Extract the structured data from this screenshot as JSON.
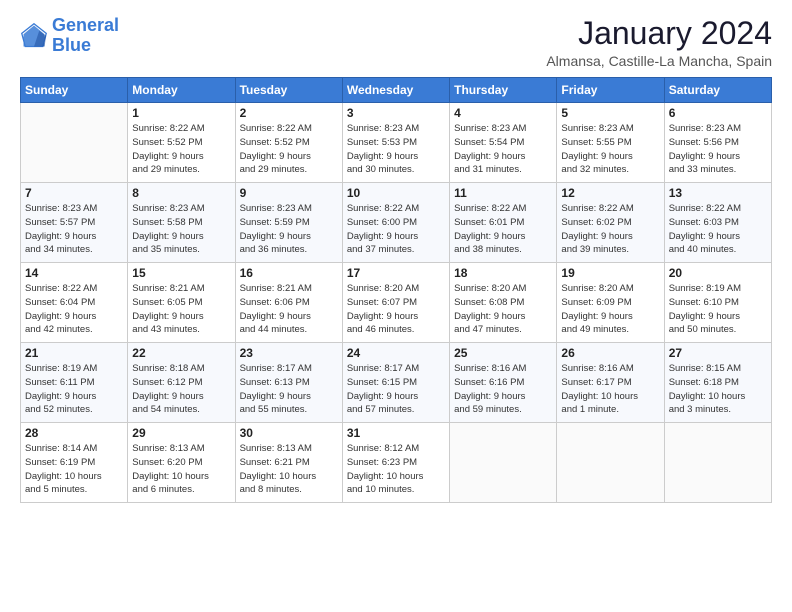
{
  "logo": {
    "line1": "General",
    "line2": "Blue"
  },
  "title": "January 2024",
  "location": "Almansa, Castille-La Mancha, Spain",
  "days_of_week": [
    "Sunday",
    "Monday",
    "Tuesday",
    "Wednesday",
    "Thursday",
    "Friday",
    "Saturday"
  ],
  "weeks": [
    [
      {
        "day": "",
        "info": ""
      },
      {
        "day": "1",
        "info": "Sunrise: 8:22 AM\nSunset: 5:52 PM\nDaylight: 9 hours\nand 29 minutes."
      },
      {
        "day": "2",
        "info": "Sunrise: 8:22 AM\nSunset: 5:52 PM\nDaylight: 9 hours\nand 29 minutes."
      },
      {
        "day": "3",
        "info": "Sunrise: 8:23 AM\nSunset: 5:53 PM\nDaylight: 9 hours\nand 30 minutes."
      },
      {
        "day": "4",
        "info": "Sunrise: 8:23 AM\nSunset: 5:54 PM\nDaylight: 9 hours\nand 31 minutes."
      },
      {
        "day": "5",
        "info": "Sunrise: 8:23 AM\nSunset: 5:55 PM\nDaylight: 9 hours\nand 32 minutes."
      },
      {
        "day": "6",
        "info": "Sunrise: 8:23 AM\nSunset: 5:56 PM\nDaylight: 9 hours\nand 33 minutes."
      }
    ],
    [
      {
        "day": "7",
        "info": "Sunrise: 8:23 AM\nSunset: 5:57 PM\nDaylight: 9 hours\nand 34 minutes."
      },
      {
        "day": "8",
        "info": "Sunrise: 8:23 AM\nSunset: 5:58 PM\nDaylight: 9 hours\nand 35 minutes."
      },
      {
        "day": "9",
        "info": "Sunrise: 8:23 AM\nSunset: 5:59 PM\nDaylight: 9 hours\nand 36 minutes."
      },
      {
        "day": "10",
        "info": "Sunrise: 8:22 AM\nSunset: 6:00 PM\nDaylight: 9 hours\nand 37 minutes."
      },
      {
        "day": "11",
        "info": "Sunrise: 8:22 AM\nSunset: 6:01 PM\nDaylight: 9 hours\nand 38 minutes."
      },
      {
        "day": "12",
        "info": "Sunrise: 8:22 AM\nSunset: 6:02 PM\nDaylight: 9 hours\nand 39 minutes."
      },
      {
        "day": "13",
        "info": "Sunrise: 8:22 AM\nSunset: 6:03 PM\nDaylight: 9 hours\nand 40 minutes."
      }
    ],
    [
      {
        "day": "14",
        "info": "Sunrise: 8:22 AM\nSunset: 6:04 PM\nDaylight: 9 hours\nand 42 minutes."
      },
      {
        "day": "15",
        "info": "Sunrise: 8:21 AM\nSunset: 6:05 PM\nDaylight: 9 hours\nand 43 minutes."
      },
      {
        "day": "16",
        "info": "Sunrise: 8:21 AM\nSunset: 6:06 PM\nDaylight: 9 hours\nand 44 minutes."
      },
      {
        "day": "17",
        "info": "Sunrise: 8:20 AM\nSunset: 6:07 PM\nDaylight: 9 hours\nand 46 minutes."
      },
      {
        "day": "18",
        "info": "Sunrise: 8:20 AM\nSunset: 6:08 PM\nDaylight: 9 hours\nand 47 minutes."
      },
      {
        "day": "19",
        "info": "Sunrise: 8:20 AM\nSunset: 6:09 PM\nDaylight: 9 hours\nand 49 minutes."
      },
      {
        "day": "20",
        "info": "Sunrise: 8:19 AM\nSunset: 6:10 PM\nDaylight: 9 hours\nand 50 minutes."
      }
    ],
    [
      {
        "day": "21",
        "info": "Sunrise: 8:19 AM\nSunset: 6:11 PM\nDaylight: 9 hours\nand 52 minutes."
      },
      {
        "day": "22",
        "info": "Sunrise: 8:18 AM\nSunset: 6:12 PM\nDaylight: 9 hours\nand 54 minutes."
      },
      {
        "day": "23",
        "info": "Sunrise: 8:17 AM\nSunset: 6:13 PM\nDaylight: 9 hours\nand 55 minutes."
      },
      {
        "day": "24",
        "info": "Sunrise: 8:17 AM\nSunset: 6:15 PM\nDaylight: 9 hours\nand 57 minutes."
      },
      {
        "day": "25",
        "info": "Sunrise: 8:16 AM\nSunset: 6:16 PM\nDaylight: 9 hours\nand 59 minutes."
      },
      {
        "day": "26",
        "info": "Sunrise: 8:16 AM\nSunset: 6:17 PM\nDaylight: 10 hours\nand 1 minute."
      },
      {
        "day": "27",
        "info": "Sunrise: 8:15 AM\nSunset: 6:18 PM\nDaylight: 10 hours\nand 3 minutes."
      }
    ],
    [
      {
        "day": "28",
        "info": "Sunrise: 8:14 AM\nSunset: 6:19 PM\nDaylight: 10 hours\nand 5 minutes."
      },
      {
        "day": "29",
        "info": "Sunrise: 8:13 AM\nSunset: 6:20 PM\nDaylight: 10 hours\nand 6 minutes."
      },
      {
        "day": "30",
        "info": "Sunrise: 8:13 AM\nSunset: 6:21 PM\nDaylight: 10 hours\nand 8 minutes."
      },
      {
        "day": "31",
        "info": "Sunrise: 8:12 AM\nSunset: 6:23 PM\nDaylight: 10 hours\nand 10 minutes."
      },
      {
        "day": "",
        "info": ""
      },
      {
        "day": "",
        "info": ""
      },
      {
        "day": "",
        "info": ""
      }
    ]
  ]
}
